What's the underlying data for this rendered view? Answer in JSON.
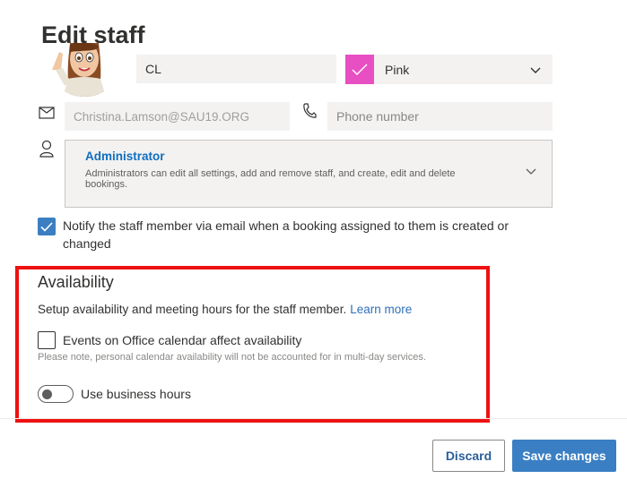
{
  "page": {
    "title": "Edit staff"
  },
  "staff": {
    "initials_value": "CL",
    "color": {
      "name": "Pink",
      "swatch": "#e84fc3"
    },
    "email_value": "Christina.Lamson@SAU19.ORG",
    "phone_placeholder": "Phone number"
  },
  "role": {
    "name": "Administrator",
    "description": "Administrators can edit all settings, add and remove staff, and create, edit and delete bookings."
  },
  "notify": {
    "checked": true,
    "label": "Notify the staff member via email when a booking assigned to them is created or changed"
  },
  "availability": {
    "title": "Availability",
    "description": "Setup availability and meeting hours for the staff member.",
    "learn_more": "Learn more",
    "events_label": "Events on Office calendar affect availability",
    "events_checked": false,
    "events_note": "Please note, personal calendar availability will not be accounted for in multi-day services.",
    "business_hours_label": "Use business hours",
    "business_hours_on": false,
    "highlight_color": "#ee1111"
  },
  "footer": {
    "discard_label": "Discard",
    "save_label": "Save changes"
  },
  "colors": {
    "accent": "#3a7fc4",
    "link": "#2f6fb8"
  },
  "icons": {
    "mail": "mail-icon",
    "phone": "phone-icon",
    "person": "person-icon",
    "chevron": "chevron-down-icon",
    "check": "checkmark-icon"
  }
}
